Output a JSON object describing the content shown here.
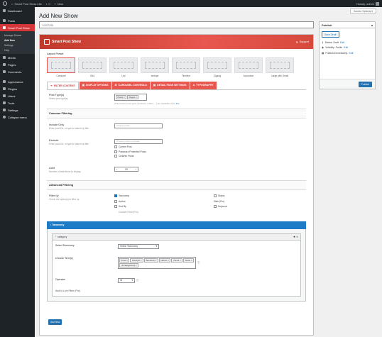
{
  "adminbar": {
    "site_name": "Smart Post Show Lite",
    "comments_count": "0",
    "new_label": "New",
    "howdy": "Howdy, admin"
  },
  "sidebar": {
    "items": [
      {
        "label": "Dashboard"
      },
      {
        "label": "Posts"
      },
      {
        "label": "Smart Post Show"
      },
      {
        "label": "Media"
      },
      {
        "label": "Pages"
      },
      {
        "label": "Comments"
      },
      {
        "label": "Appearance"
      },
      {
        "label": "Plugins"
      },
      {
        "label": "Users"
      },
      {
        "label": "Tools"
      },
      {
        "label": "Settings"
      },
      {
        "label": "Collapse menu"
      }
    ],
    "submenu": [
      "Manage Shows",
      "Add New",
      "Settings",
      "Help"
    ]
  },
  "screen_options": "Screen Options",
  "page_title": "Add New Show",
  "title_placeholder": "Add title",
  "publish": {
    "heading": "Publish",
    "save_draft": "Save Draft",
    "status_label": "Status: Draft",
    "status_edit": "Edit",
    "visibility_label": "Visibility: Public",
    "visibility_edit": "Edit",
    "publish_time": "Publish immediately",
    "publish_edit": "Edit",
    "publish_button": "Publish"
  },
  "sps": {
    "title": "Smart Post Show",
    "support": "Support",
    "layout_preset_label": "Layout Preset",
    "layouts": [
      {
        "name": "Carousel"
      },
      {
        "name": "Grid"
      },
      {
        "name": "List"
      },
      {
        "name": "Isotope"
      },
      {
        "name": "Timeline"
      },
      {
        "name": "Zigzag"
      },
      {
        "name": "Accordion"
      },
      {
        "name": "Large with Small"
      }
    ],
    "tabs": [
      {
        "label": "FILTER CONTENT"
      },
      {
        "label": "DISPLAY OPTIONS"
      },
      {
        "label": "CAROUSEL CONTROLS"
      },
      {
        "label": "DETAIL PAGE SETTINGS"
      },
      {
        "label": "TYPOGRAPHY"
      }
    ]
  },
  "filter": {
    "post_types_label": "Post Type(s)",
    "post_types_desc": "Select post type(s).",
    "post_types_selected": [
      "Posts",
      "Pages"
    ],
    "post_types_hint": "(The custom post types (products, orders, ...) are available in the",
    "post_types_hint_link": "Pro",
    "common_heading": "Common Filtering",
    "include_only_label": "Include Only",
    "include_only_desc": "Enter post IDs, or type to search by title.",
    "include_only_placeholder": "Choose posts",
    "exclude_label": "Exclude",
    "exclude_desc": "Enter post IDs, or type to search by title.",
    "exclude_placeholder": "Choose posts to exclude",
    "exclude_options": [
      "Current Post",
      "Password Protected Posts",
      "Children Posts"
    ],
    "limit_label": "Limit",
    "limit_desc": "Number of total items to display.",
    "limit_value": "20",
    "advanced_heading": "Advanced Filtering",
    "filter_by_label": "Filter by",
    "filter_by_desc": "Check the option(s) to filter by.",
    "filter_options": [
      {
        "label": "Taxonomy",
        "checked": true
      },
      {
        "label": "Status",
        "checked": false
      },
      {
        "label": "Author",
        "checked": false
      },
      {
        "label": "Date (Pro)",
        "checked": false
      },
      {
        "label": "Sort By",
        "checked": false
      },
      {
        "label": "Keyword",
        "checked": false
      },
      {
        "label": "Custom Field (Pro)",
        "checked": false
      }
    ]
  },
  "taxonomy": {
    "bar_label": "Taxonomy",
    "group_label": "category",
    "select_taxonomy_label": "Select Taxonomy",
    "select_taxonomy_value": "Select Taxonomy",
    "choose_terms_label": "Choose Term(s)",
    "terms": [
      "Food",
      "Lifestyle",
      "Business",
      "Nature",
      "Travel",
      "News",
      "Uncategorized"
    ],
    "operator_label": "Operator",
    "operator_value": "IN",
    "add_to_filter": "Add to Live Filter (Pro)",
    "add_new": "Add New"
  }
}
